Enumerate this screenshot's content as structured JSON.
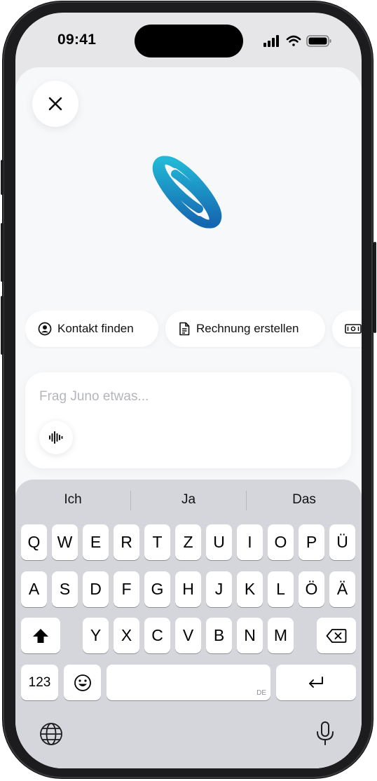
{
  "status_bar": {
    "time": "09:41"
  },
  "quick_actions": [
    {
      "label": "Kontakt finden",
      "icon": "user-circle-icon"
    },
    {
      "label": "Rechnung erstellen",
      "icon": "document-icon"
    },
    {
      "label": "",
      "icon": "banknote-icon"
    }
  ],
  "input": {
    "placeholder": "Frag Juno etwas..."
  },
  "keyboard": {
    "suggestions": [
      "Ich",
      "Ja",
      "Das"
    ],
    "row1": [
      "Q",
      "W",
      "E",
      "R",
      "T",
      "Z",
      "U",
      "I",
      "O",
      "P",
      "Ü"
    ],
    "row2": [
      "A",
      "S",
      "D",
      "F",
      "G",
      "H",
      "J",
      "K",
      "L",
      "Ö",
      "Ä"
    ],
    "row3": [
      "Y",
      "X",
      "C",
      "V",
      "B",
      "N",
      "M"
    ],
    "numbers_key": "123",
    "space_language": "DE"
  },
  "colors": {
    "logo_gradient_top": "#22b8d6",
    "logo_gradient_bottom": "#1566b0",
    "sheet_background": "#f7f8fa",
    "keyboard_background": "#d5d6db"
  }
}
